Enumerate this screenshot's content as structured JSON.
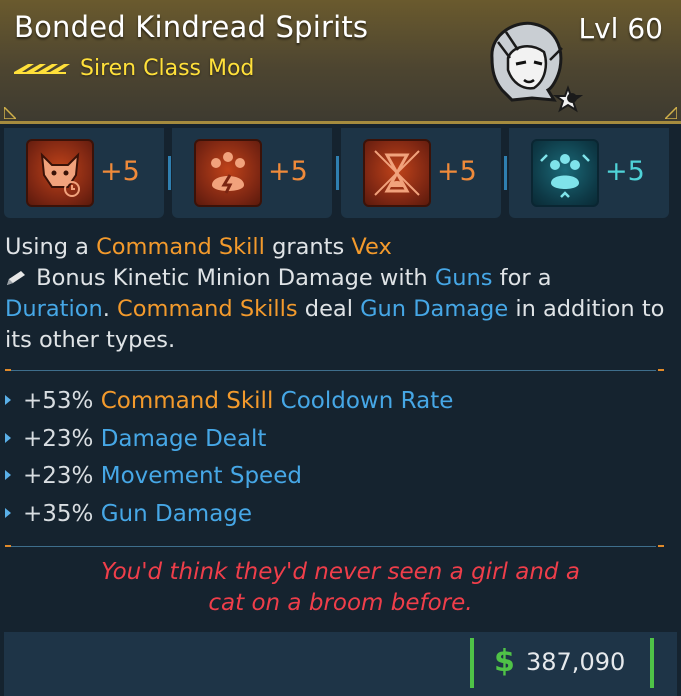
{
  "item": {
    "name": "Bonded Kindread Spirits",
    "level": "Lvl 60",
    "class_mod": "Siren Class Mod",
    "rarity_color": "#ffe03a",
    "portrait_icon": "siren-vex-portrait-icon"
  },
  "skills": [
    {
      "icon": "fox-timer-skill-icon",
      "points": "+5",
      "color": "orange"
    },
    {
      "icon": "paw-lightning-skill-icon",
      "points": "+5",
      "color": "orange"
    },
    {
      "icon": "hourglass-creature-skill-icon",
      "points": "+5",
      "color": "orange"
    },
    {
      "icon": "paw-arrows-skill-icon",
      "points": "+5",
      "color": "teal"
    }
  ],
  "description": {
    "p1": "Using a ",
    "k1": "Command Skill",
    "p2": " grants ",
    "k2": "Vex",
    "p3": " Bonus Kinetic Minion Damage",
    "p4": " with ",
    "k3": "Guns",
    "p5": " for a ",
    "k4": "Duration",
    "p6": ". ",
    "k5": "Command Skills",
    "p7": " deal ",
    "k6": "Gun Damage",
    "p8": " in addition to its other types."
  },
  "stats": [
    {
      "value": "+53% ",
      "orange": "Command Skill",
      "blue": " Cooldown Rate"
    },
    {
      "value": "+23% ",
      "orange": "",
      "blue": "Damage Dealt"
    },
    {
      "value": "+23% ",
      "orange": "",
      "blue": "Movement Speed"
    },
    {
      "value": "+35% ",
      "orange": "",
      "blue": "Gun Damage"
    }
  ],
  "flavor": {
    "line1": "You'd think they'd never seen a girl and a",
    "line2": "cat on a broom before."
  },
  "price": {
    "currency_symbol": "$",
    "amount": "387,090"
  },
  "colors": {
    "header": "#5a4e2c",
    "keyword_orange": "#f39a2c",
    "keyword_blue": "#46a7e6",
    "flavor_red": "#ef3e4a",
    "price_green": "#4fc247"
  }
}
